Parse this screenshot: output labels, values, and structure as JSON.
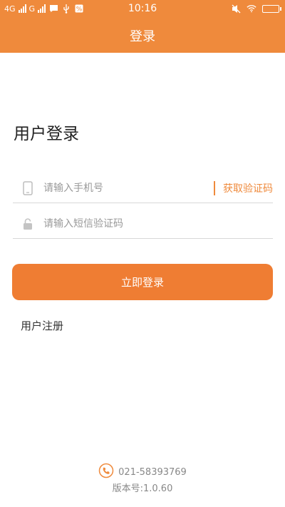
{
  "status_bar": {
    "network_1": "4G",
    "network_2": "G",
    "time": "10:16"
  },
  "header": {
    "title": "登录"
  },
  "page": {
    "heading": "用户登录"
  },
  "form": {
    "phone_placeholder": "请输入手机号",
    "phone_value": "",
    "get_code_label": "获取验证码",
    "code_placeholder": "请输入短信验证码",
    "code_value": ""
  },
  "actions": {
    "login_label": "立即登录",
    "register_label": "用户注册"
  },
  "footer": {
    "phone": "021-58393769",
    "version": "版本号:1.0.60"
  },
  "colors": {
    "accent": "#ef8a3c",
    "button": "#ef7d33"
  },
  "icons": {
    "phone_field": "mobile-phone-icon",
    "code_field": "lock-icon",
    "footer": "phone-call-icon"
  }
}
